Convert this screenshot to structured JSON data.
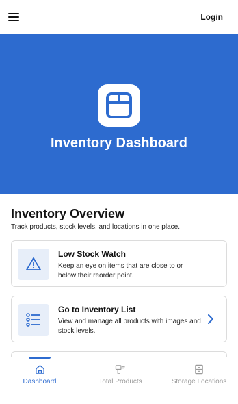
{
  "header": {
    "login_label": "Login",
    "menu_icon": "hamburger-menu-icon"
  },
  "hero": {
    "title": "Inventory Dashboard",
    "icon": "box-icon",
    "background_color": "#2d6bcf"
  },
  "overview": {
    "title": "Inventory Overview",
    "subtitle": "Track products, stock levels, and locations in one place."
  },
  "cards": [
    {
      "title": "Low Stock Watch",
      "description": "Keep an eye on items that are close to or below their reorder point.",
      "icon": "warning-triangle-icon"
    },
    {
      "title": "Go to Inventory List",
      "description": "View and manage all products with images and stock levels.",
      "icon": "list-icon",
      "action_icon": "chevron-right-icon"
    }
  ],
  "bottom_nav": {
    "items": [
      {
        "label": "Dashboard",
        "icon": "home-icon",
        "active": true
      },
      {
        "label": "Total Products",
        "icon": "product-icon",
        "active": false
      },
      {
        "label": "Storage Locations",
        "icon": "storage-icon",
        "active": false
      }
    ],
    "accent_color": "#2d6bcf"
  }
}
